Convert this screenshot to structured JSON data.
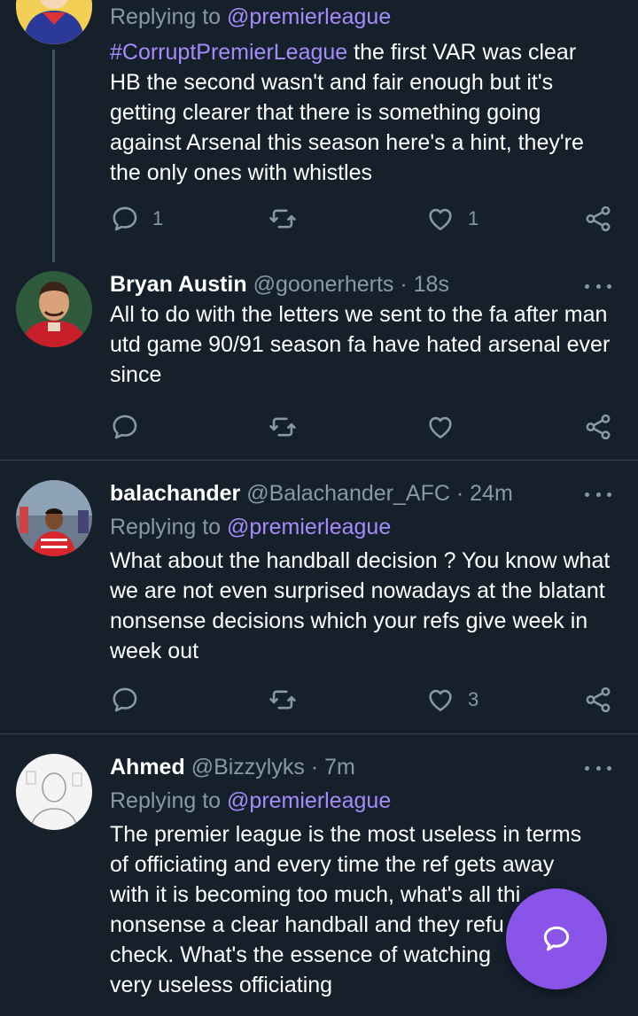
{
  "tweets": [
    {
      "id": "t0",
      "replying_prefix": "Replying to",
      "replying_handle": "@premierleague",
      "hashtag": "#CorruptPremierLeague",
      "body": " the first VAR was clear HB the second wasn't and fair enough but it's getting clearer that there is something going against Arsenal this season  here's a hint, they're the only ones with whistles",
      "reply_count": "1",
      "retweet_count": "",
      "like_count": "1"
    },
    {
      "id": "t1",
      "name": "Bryan Austin",
      "handle": "@goonerherts",
      "time": "· 18s",
      "body": "All to do with the letters we sent to the fa after man utd game 90/91 season fa have hated arsenal ever since",
      "reply_count": "",
      "retweet_count": "",
      "like_count": ""
    },
    {
      "id": "t2",
      "name": "balachander",
      "handle": "@Balachander_AFC",
      "time": "· 24m",
      "replying_prefix": "Replying to",
      "replying_handle": "@premierleague",
      "body": "What about the handball decision ? You know what we are not even surprised nowadays at the blatant nonsense decisions which your refs give week in week out",
      "reply_count": "",
      "retweet_count": "",
      "like_count": "3"
    },
    {
      "id": "t3",
      "name": "Ahmed",
      "handle": "@Bizzylyks",
      "time": "· 7m",
      "replying_prefix": "Replying to",
      "replying_handle": "@premierleague",
      "body_lines": [
        "The premier league is the most useless in terms",
        "of officiating and every time the ref gets away",
        "with it is becoming too much, what's all thi",
        "nonsense a clear handball and they refu",
        "check. What's the essence of watching",
        "very useless officiating"
      ]
    }
  ],
  "icons": {
    "reply": "reply-icon",
    "retweet": "retweet-icon",
    "like": "heart-icon",
    "share": "share-icon",
    "more": "more-icon",
    "compose": "compose-icon"
  },
  "colors": {
    "background": "#15202b",
    "divider": "#38444d",
    "secondary_text": "#8899a6",
    "accent": "#a78bfa",
    "fab": "#8b54e8"
  }
}
